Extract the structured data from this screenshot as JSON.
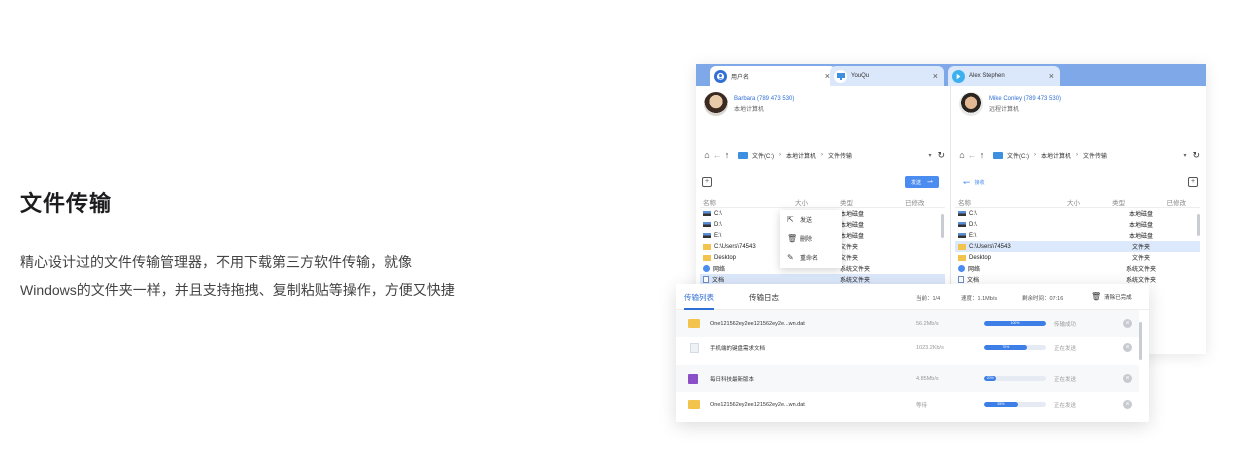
{
  "intro": {
    "title": "文件传输",
    "line1": "精心设计过的文件传输管理器，不用下载第三方软件传输，就像",
    "line2": "Windows的文件夹一样，并且支持拖拽、复制粘贴等操作，方便又快捷"
  },
  "window": {
    "tabs": [
      {
        "label": "用户名",
        "icon": "user-badge-icon",
        "color": "#2f6fd6"
      },
      {
        "label": "YouQu",
        "icon": "monitor-icon",
        "color": "#3d8fe0"
      },
      {
        "label": "Alex Stephen",
        "icon": "remote-icon",
        "color": "#3db0f0"
      }
    ],
    "close_glyph": "×",
    "left": {
      "user_name": "Barbara (789 473 530)",
      "user_role": "本地计算机",
      "crumbs": [
        "文件(C:)",
        "本地计算机",
        "文件传输"
      ],
      "send_label": "发送",
      "columns": [
        "名称",
        "大小",
        "类型",
        "已修改"
      ],
      "rows": [
        {
          "name": "C:\\",
          "type": "本地磁盘",
          "icon": "drive"
        },
        {
          "name": "D:\\",
          "type": "本地磁盘",
          "icon": "drive"
        },
        {
          "name": "E:\\",
          "type": "本地磁盘",
          "icon": "drive"
        },
        {
          "name": "C:\\Users\\74543",
          "type": "文件夹",
          "icon": "folder"
        },
        {
          "name": "Desktop",
          "type": "文件夹",
          "icon": "folder"
        },
        {
          "name": "网络",
          "type": "系统文件夹",
          "icon": "network"
        },
        {
          "name": "文档",
          "type": "系统文件夹",
          "icon": "doc"
        }
      ]
    },
    "right": {
      "user_name": "Mike Conley (789 473 530)",
      "user_role": "远程计算机",
      "crumbs": [
        "文件(C:)",
        "本地计算机",
        "文件传输"
      ],
      "receive_label": "接收",
      "columns": [
        "名称",
        "大小",
        "类型",
        "已修改"
      ],
      "rows": [
        {
          "name": "C:\\",
          "type": "本地磁盘",
          "icon": "drive"
        },
        {
          "name": "D:\\",
          "type": "本地磁盘",
          "icon": "drive"
        },
        {
          "name": "E:\\",
          "type": "本地磁盘",
          "icon": "drive"
        },
        {
          "name": "C:\\Users\\74543",
          "type": "文件夹",
          "icon": "folder"
        },
        {
          "name": "Desktop",
          "type": "文件夹",
          "icon": "folder"
        },
        {
          "name": "网络",
          "type": "系统文件夹",
          "icon": "network"
        },
        {
          "name": "文档",
          "type": "系统文件夹",
          "icon": "doc"
        }
      ]
    },
    "context_menu": [
      {
        "label": "发送",
        "icon": "send-icon"
      },
      {
        "label": "删除",
        "icon": "trash-icon"
      },
      {
        "label": "重命名",
        "icon": "pencil-icon"
      }
    ]
  },
  "transfer": {
    "tab_list": "传输列表",
    "tab_log": "传输日志",
    "current": "当前：1/4",
    "speed": "速度：1.1Mb/s",
    "remaining": "剩余时间：07:16",
    "clear": "清除已完成",
    "rows": [
      {
        "name": "One121562ey2ee121562ey2e...wn.dat",
        "speed": "56.2Mb/s",
        "progress": 1.0,
        "progress_label": "100%",
        "status": "传输成功",
        "icon": "folder-icon"
      },
      {
        "name": "手机端的键盘需求文档",
        "speed": "1023.2Kb/s",
        "progress": 0.7,
        "progress_label": "70%",
        "status": "正在发送",
        "icon": "document-icon"
      },
      {
        "name": "每日科技最新版本",
        "speed": "4.85Mb/s",
        "progress": 0.2,
        "progress_label": "20%",
        "status": "正在发送",
        "icon": "video-icon"
      },
      {
        "name": "One121562ey2ee121562ey2e...wn.dat",
        "speed": "等待",
        "progress": 0.55,
        "progress_label": "55%",
        "status": "正在发送",
        "icon": "folder-icon"
      }
    ]
  }
}
